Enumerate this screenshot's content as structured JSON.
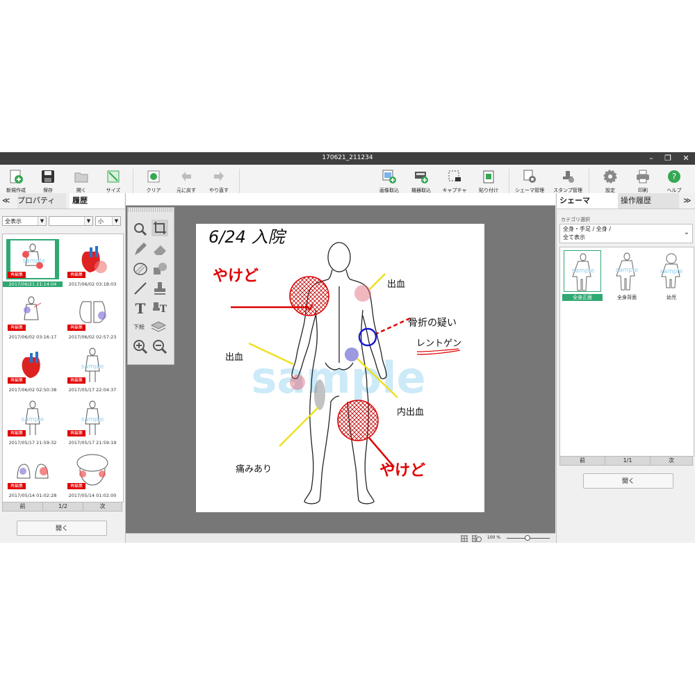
{
  "window": {
    "title": "170621_211234"
  },
  "toolbar": {
    "left": [
      {
        "label": "新規作成",
        "icon": "new-icon"
      },
      {
        "label": "保存",
        "icon": "save-icon"
      },
      {
        "label": "開く",
        "icon": "folder-icon"
      },
      {
        "label": "サイズ",
        "icon": "resize-icon"
      },
      {
        "label": "クリア",
        "icon": "clear-icon"
      },
      {
        "label": "元に戻す",
        "icon": "undo-icon"
      },
      {
        "label": "やり直す",
        "icon": "redo-icon"
      }
    ],
    "right": [
      {
        "label": "画像取込",
        "icon": "image-import-icon"
      },
      {
        "label": "機器取込",
        "icon": "device-import-icon"
      },
      {
        "label": "キャプチャ",
        "icon": "capture-icon"
      },
      {
        "label": "貼り付け",
        "icon": "paste-icon"
      },
      {
        "label": "シェーマ管理",
        "icon": "schema-manage-icon"
      },
      {
        "label": "スタンプ管理",
        "icon": "stamp-manage-icon"
      },
      {
        "label": "設定",
        "icon": "gear-icon"
      },
      {
        "label": "印刷",
        "icon": "printer-icon"
      },
      {
        "label": "ヘルプ",
        "icon": "help-icon"
      }
    ]
  },
  "left_panel": {
    "collapse_glyph": "≪",
    "tabs": [
      "プロパティ",
      "履歴"
    ],
    "active_tab": "履歴",
    "filter1": "全表示",
    "filter2": "",
    "size": "小",
    "badge": "再編集",
    "history": [
      "2017/06/21 21:14:04",
      "2017/06/02 03:18:03",
      "2017/06/02 03:16:17",
      "2017/06/02 02:57:23",
      "2017/06/02 02:50:38",
      "2017/05/17 22:04:37",
      "2017/05/17 21:59:32",
      "2017/05/17 21:59:19",
      "2017/05/14 01:02:28",
      "2017/05/14 01:02:00"
    ],
    "pager": {
      "prev": "前",
      "page": "1/2",
      "next": "次"
    },
    "open_label": "開く"
  },
  "canvas": {
    "heading": "6/24 入院",
    "watermark": "sample",
    "annotations": {
      "burn_top": "やけど",
      "bleed_right": "出血",
      "fracture": "骨折の疑い",
      "xray": "レントゲン",
      "bleed_left": "出血",
      "internal_bleed": "内出血",
      "pain": "痛みあり",
      "burn_bottom": "やけど"
    },
    "tool_under_label": "下絵",
    "zoom": "100 %"
  },
  "right_panel": {
    "tabs": [
      "シェーマ",
      "操作履歴"
    ],
    "active_tab": "シェーマ",
    "expand_glyph": "≫",
    "category_label": "カテゴリ選択",
    "category_line1": "全身・手足 / 全身 /",
    "category_line2": "全て表示",
    "schemas": [
      "全身正面",
      "全身背面",
      "幼児"
    ],
    "pager": {
      "prev": "前",
      "page": "1/1",
      "next": "次"
    },
    "open_label": "開く"
  }
}
